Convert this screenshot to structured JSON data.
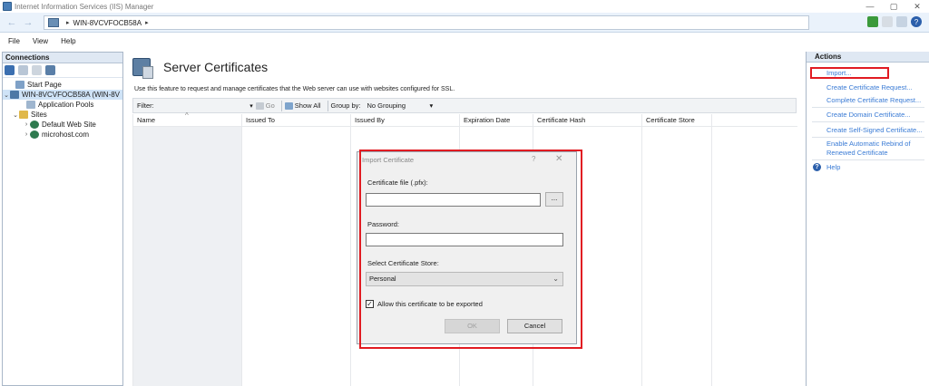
{
  "window": {
    "title": "Internet Information Services (IIS) Manager",
    "controls": {
      "minimize": "—",
      "maximize": "▢",
      "close": "✕"
    }
  },
  "address": {
    "back": "←",
    "forward": "→",
    "crumb": "WIN-8VCVFOCB58A",
    "sep1": "▸",
    "sep2": "▸"
  },
  "menu": {
    "file": "File",
    "view": "View",
    "help": "Help"
  },
  "connections": {
    "header": "Connections",
    "tree": [
      {
        "label": "Start Page",
        "exp": ""
      },
      {
        "label": "WIN-8VCVFOCB58A (WIN-8V",
        "exp": "⌄"
      },
      {
        "label": "Application Pools",
        "exp": ""
      },
      {
        "label": "Sites",
        "exp": "⌄"
      },
      {
        "label": "Default Web Site",
        "exp": "›"
      },
      {
        "label": "microhost.com",
        "exp": "›"
      }
    ]
  },
  "main": {
    "title": "Server Certificates",
    "description": "Use this feature to request and manage certificates that the Web server can use with websites configured for SSL.",
    "filter": {
      "label": "Filter:",
      "dropdown_arrow": "▾",
      "go": "Go",
      "show_all": "Show All",
      "group_by_label": "Group by:",
      "group_by_value": "No Grouping"
    },
    "columns": [
      "Name",
      "Issued To",
      "Issued By",
      "Expiration Date",
      "Certificate Hash",
      "Certificate Store"
    ],
    "sort_caret": "^"
  },
  "dialog": {
    "title": "Import Certificate",
    "help": "?",
    "close": "✕",
    "file_label": "Certificate file (.pfx):",
    "file_value": "",
    "browse": "...",
    "password_label": "Password:",
    "password_value": "",
    "store_label": "Select Certificate Store:",
    "store_value": "Personal",
    "store_chev": "⌄",
    "allow_export_label": "Allow this certificate to be exported",
    "allow_export_checked": "✓",
    "ok": "OK",
    "cancel": "Cancel"
  },
  "actions": {
    "header": "Actions",
    "import": "Import...",
    "create_request": "Create Certificate Request...",
    "complete_request": "Complete Certificate Request...",
    "create_domain": "Create Domain Certificate...",
    "create_selfsigned": "Create Self-Signed Certificate...",
    "auto_rebind_1": "Enable Automatic Rebind of",
    "auto_rebind_2": "Renewed Certificate",
    "help": "Help",
    "help_glyph": "?"
  },
  "colors": {
    "accent_link": "#3a7bd5",
    "highlight": "#e11b22"
  }
}
